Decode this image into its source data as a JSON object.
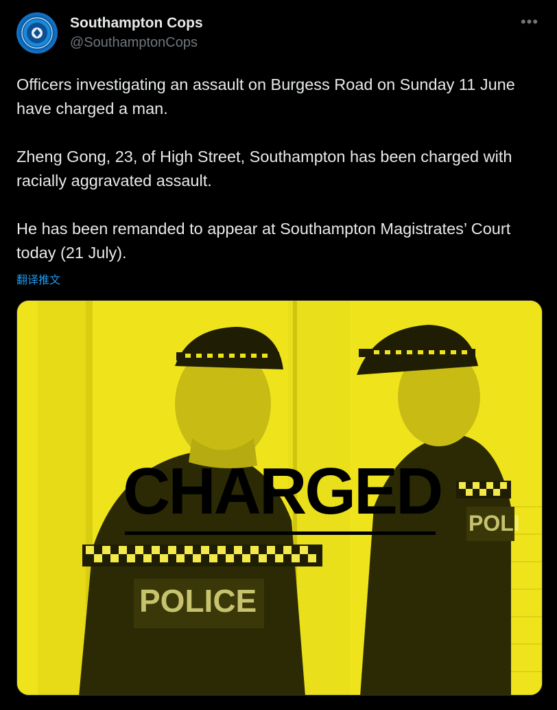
{
  "account": {
    "display_name": "Southampton Cops",
    "handle": "@SouthamptonCops",
    "avatar_icon": "police-crest-icon"
  },
  "more_icon": "more-options-icon",
  "tweet": {
    "paragraphs": [
      "Officers investigating an assault on Burgess Road on Sunday 11 June have charged a man.",
      "Zheng Gong, 23, of High Street, Southampton has been charged with racially aggravated assault.",
      "He has been remanded to appear at Southampton Magistrates’ Court today (21 July)."
    ],
    "translate_label": "翻译推文"
  },
  "media": {
    "headline": "CHARGED",
    "vest_text_1": "POLICE",
    "vest_text_2": "POLI",
    "tint_color": "#efe41c"
  },
  "colors": {
    "background": "#000000",
    "text_primary": "#e7e9ea",
    "text_secondary": "#71767b",
    "link": "#1d9bf0"
  }
}
